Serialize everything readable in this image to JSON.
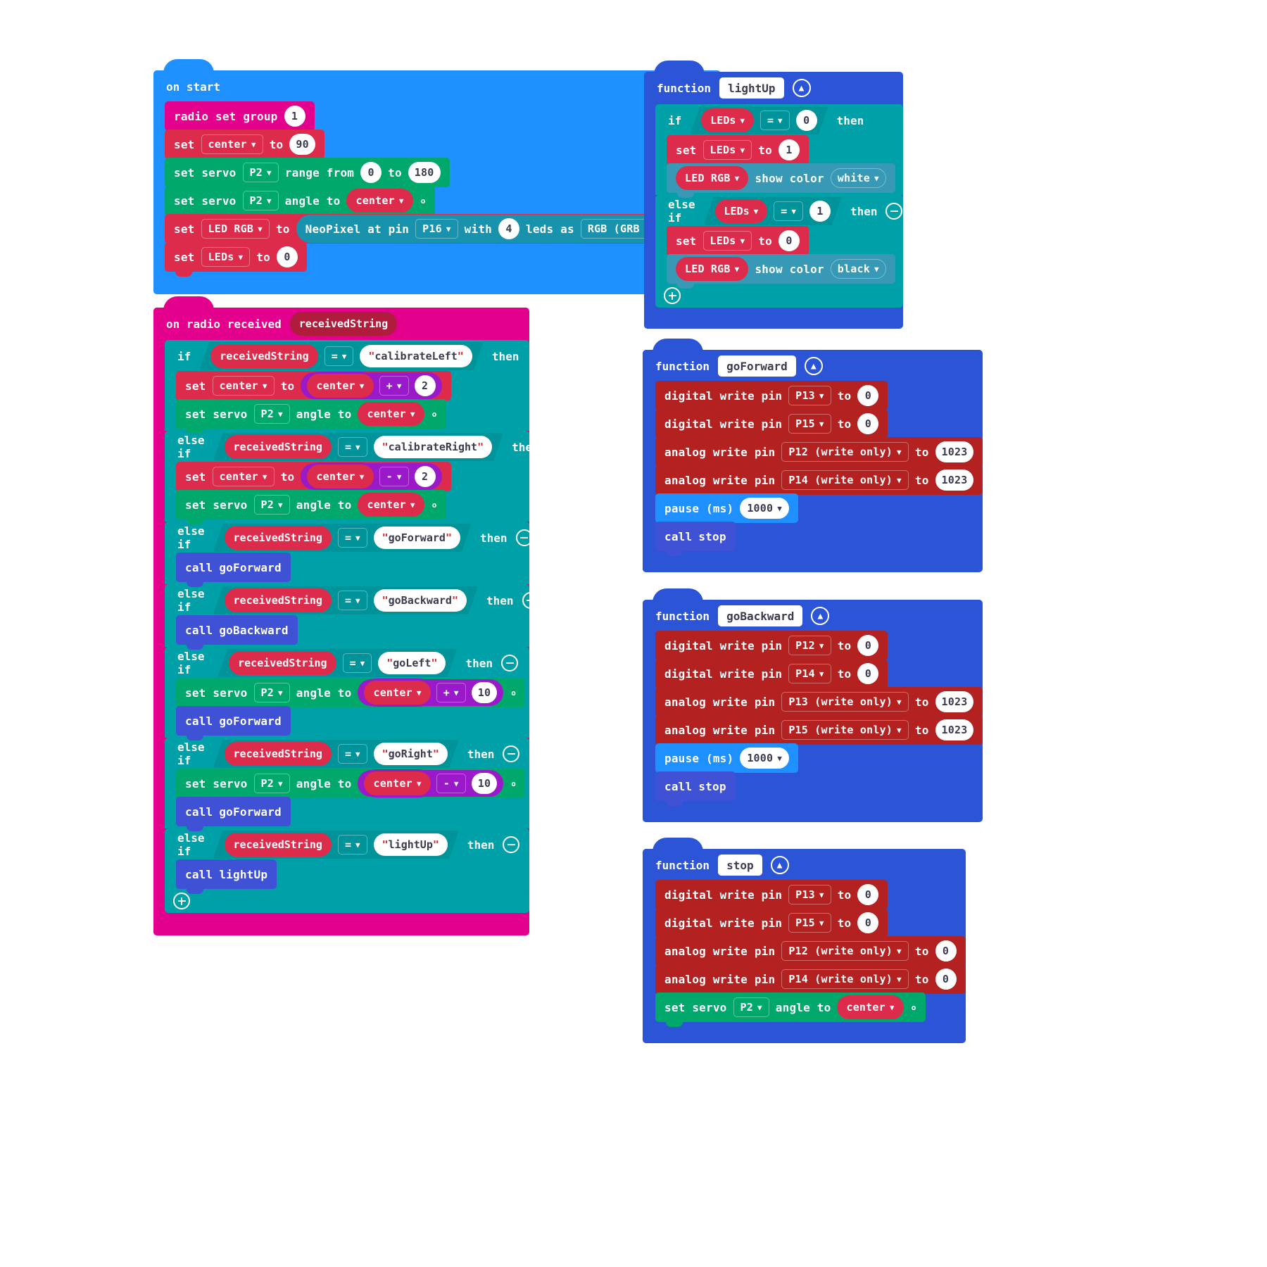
{
  "meta": {
    "app": "MakeCode Blocks Editor",
    "canvas_bg": "#ffffff"
  },
  "colors": {
    "event": "#1e90ff",
    "radio": "#e2008c",
    "variables": "#dd2c4b",
    "servo": "#00a86b",
    "neopixel": "#1993ad",
    "logic": "#00a0a8",
    "functions": "#2b55d6",
    "function_call": "#3f51d5",
    "pins": "#b32121",
    "math": "#9a1ac9",
    "basic": "#1e90ff"
  },
  "labels": {
    "if": "if",
    "else_if": "else if",
    "then": "then",
    "to": "to",
    "set": "set",
    "function": "function",
    "call": "call",
    "degree": "°",
    "with": "with",
    "leds_as": "leds as",
    "range_from": "range from",
    "angle_to": "angle to",
    "show_color": "show color",
    "pause_ms": "pause (ms)",
    "digital_write_pin": "digital write pin",
    "analog_write_pin": "analog write pin",
    "set_servo": "set servo",
    "radio_set_group": "radio set group",
    "neopixel_at_pin": "NeoPixel at pin",
    "equals": "="
  },
  "scripts": {
    "on_start": {
      "hat": "on start",
      "blocks": [
        {
          "kind": "radio_group",
          "text": "radio set group",
          "value": "1"
        },
        {
          "kind": "set_var",
          "text": "set",
          "variable": "center",
          "value": "90"
        },
        {
          "kind": "servo_range",
          "text": "set servo",
          "pin": "P2",
          "mid": "range from",
          "from": "0",
          "to_label": "to",
          "to": "180"
        },
        {
          "kind": "servo_angle",
          "text": "set servo",
          "pin": "P2",
          "mid": "angle to",
          "value": "center"
        },
        {
          "kind": "set_neopixel",
          "text": "set",
          "variable": "LED RGB",
          "to": "to",
          "neo": {
            "text": "NeoPixel at pin",
            "pin": "P16",
            "with": "with",
            "count": "4",
            "leds_as": "leds as",
            "format": "RGB (GRB format)"
          }
        },
        {
          "kind": "set_var",
          "text": "set",
          "variable": "LEDs",
          "value": "0"
        }
      ]
    },
    "on_radio_received": {
      "hat": "on radio received",
      "hat_param": "receivedString",
      "branches": [
        {
          "keyword": "if",
          "lhs": "receivedString",
          "op": "=",
          "rhs": "calibrateLeft",
          "removable": false,
          "body": [
            {
              "kind": "set_var_math",
              "text": "set",
              "variable": "center",
              "to": "to",
              "arg": "center",
              "op": "+",
              "num": "2"
            },
            {
              "kind": "servo_angle",
              "text": "set servo",
              "pin": "P2",
              "mid": "angle to",
              "value": "center"
            }
          ]
        },
        {
          "keyword": "else if",
          "lhs": "receivedString",
          "op": "=",
          "rhs": "calibrateRight",
          "removable": true,
          "body": [
            {
              "kind": "set_var_math",
              "text": "set",
              "variable": "center",
              "to": "to",
              "arg": "center",
              "op": "-",
              "num": "2"
            },
            {
              "kind": "servo_angle",
              "text": "set servo",
              "pin": "P2",
              "mid": "angle to",
              "value": "center"
            }
          ]
        },
        {
          "keyword": "else if",
          "lhs": "receivedString",
          "op": "=",
          "rhs": "goForward",
          "removable": true,
          "body": [
            {
              "kind": "call",
              "text": "call",
              "name": "goForward"
            }
          ]
        },
        {
          "keyword": "else if",
          "lhs": "receivedString",
          "op": "=",
          "rhs": "goBackward",
          "removable": true,
          "body": [
            {
              "kind": "call",
              "text": "call",
              "name": "goBackward"
            }
          ]
        },
        {
          "keyword": "else if",
          "lhs": "receivedString",
          "op": "=",
          "rhs": "goLeft",
          "removable": true,
          "body": [
            {
              "kind": "servo_angle_math",
              "text": "set servo",
              "pin": "P2",
              "mid": "angle to",
              "arg": "center",
              "op": "+",
              "num": "10"
            },
            {
              "kind": "call",
              "text": "call",
              "name": "goForward"
            }
          ]
        },
        {
          "keyword": "else if",
          "lhs": "receivedString",
          "op": "=",
          "rhs": "goRight",
          "removable": true,
          "body": [
            {
              "kind": "servo_angle_math",
              "text": "set servo",
              "pin": "P2",
              "mid": "angle to",
              "arg": "center",
              "op": "-",
              "num": "10"
            },
            {
              "kind": "call",
              "text": "call",
              "name": "goForward"
            }
          ]
        },
        {
          "keyword": "else if",
          "lhs": "receivedString",
          "op": "=",
          "rhs": "lightUp",
          "removable": true,
          "body": [
            {
              "kind": "call",
              "text": "call",
              "name": "lightUp"
            }
          ]
        }
      ]
    },
    "fn_lightUp": {
      "header": "function",
      "name": "lightUp",
      "branches": [
        {
          "keyword": "if",
          "lhs": "LEDs",
          "op": "=",
          "rhs": "0",
          "removable": false,
          "body": [
            {
              "kind": "set_var",
              "text": "set",
              "variable": "LEDs",
              "value": "1"
            },
            {
              "kind": "neo_show",
              "target": "LED RGB",
              "mid": "show color",
              "color": "white"
            }
          ]
        },
        {
          "keyword": "else if",
          "lhs": "LEDs",
          "op": "=",
          "rhs": "1",
          "removable": true,
          "body": [
            {
              "kind": "set_var",
              "text": "set",
              "variable": "LEDs",
              "value": "0"
            },
            {
              "kind": "neo_show",
              "target": "LED RGB",
              "mid": "show color",
              "color": "black"
            }
          ]
        }
      ]
    },
    "fn_goForward": {
      "header": "function",
      "name": "goForward",
      "blocks": [
        {
          "kind": "digital_write",
          "text": "digital write pin",
          "pin": "P13",
          "to": "to",
          "value": "0"
        },
        {
          "kind": "digital_write",
          "text": "digital write pin",
          "pin": "P15",
          "to": "to",
          "value": "0"
        },
        {
          "kind": "analog_write",
          "text": "analog write pin",
          "pin": "P12 (write only)",
          "to": "to",
          "value": "1023"
        },
        {
          "kind": "analog_write",
          "text": "analog write pin",
          "pin": "P14 (write only)",
          "to": "to",
          "value": "1023"
        },
        {
          "kind": "pause",
          "text": "pause (ms)",
          "value": "1000"
        },
        {
          "kind": "call",
          "text": "call",
          "name": "stop"
        }
      ]
    },
    "fn_goBackward": {
      "header": "function",
      "name": "goBackward",
      "blocks": [
        {
          "kind": "digital_write",
          "text": "digital write pin",
          "pin": "P12",
          "to": "to",
          "value": "0"
        },
        {
          "kind": "digital_write",
          "text": "digital write pin",
          "pin": "P14",
          "to": "to",
          "value": "0"
        },
        {
          "kind": "analog_write",
          "text": "analog write pin",
          "pin": "P13 (write only)",
          "to": "to",
          "value": "1023"
        },
        {
          "kind": "analog_write",
          "text": "analog write pin",
          "pin": "P15 (write only)",
          "to": "to",
          "value": "1023"
        },
        {
          "kind": "pause",
          "text": "pause (ms)",
          "value": "1000"
        },
        {
          "kind": "call",
          "text": "call",
          "name": "stop"
        }
      ]
    },
    "fn_stop": {
      "header": "function",
      "name": "stop",
      "blocks": [
        {
          "kind": "digital_write",
          "text": "digital write pin",
          "pin": "P13",
          "to": "to",
          "value": "0"
        },
        {
          "kind": "digital_write",
          "text": "digital write pin",
          "pin": "P15",
          "to": "to",
          "value": "0"
        },
        {
          "kind": "analog_write",
          "text": "analog write pin",
          "pin": "P12 (write only)",
          "to": "to",
          "value": "0"
        },
        {
          "kind": "analog_write",
          "text": "analog write pin",
          "pin": "P14 (write only)",
          "to": "to",
          "value": "0"
        },
        {
          "kind": "servo_angle",
          "text": "set servo",
          "pin": "P2",
          "mid": "angle to",
          "value": "center"
        }
      ]
    }
  }
}
